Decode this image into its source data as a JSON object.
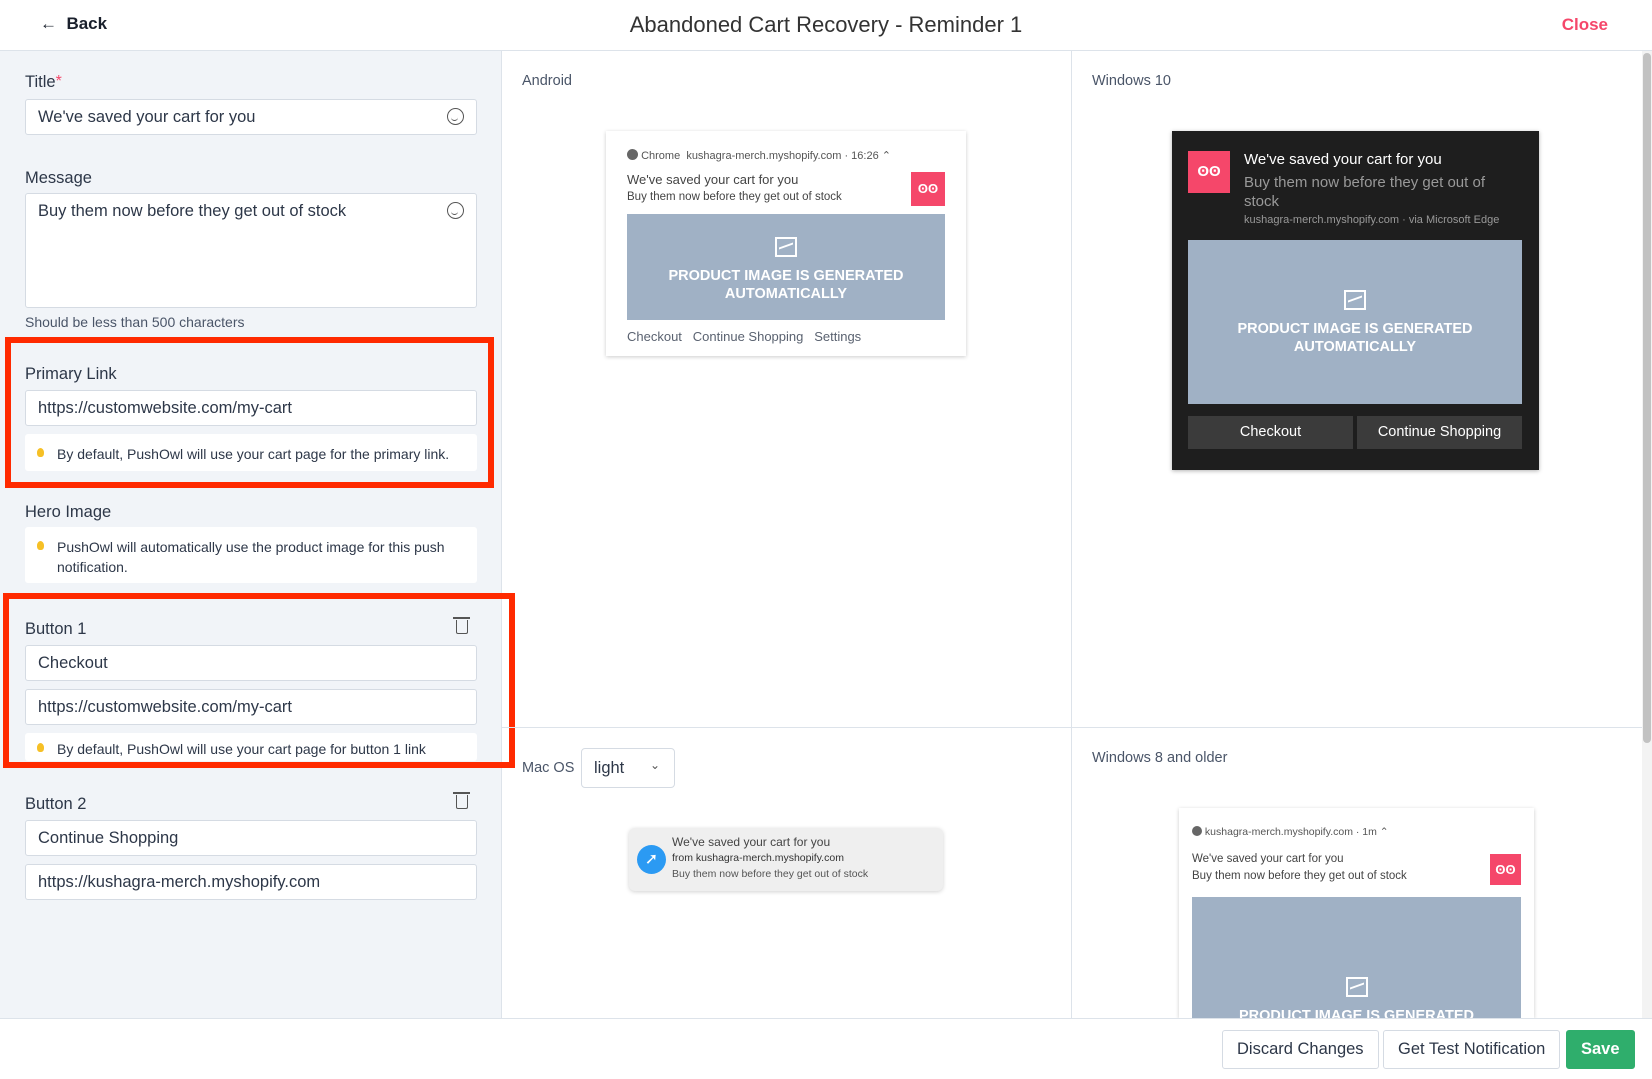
{
  "header": {
    "back": "Back",
    "title": "Abandoned Cart Recovery - Reminder 1",
    "close": "Close"
  },
  "form": {
    "title_label": "Title",
    "required_mark": "*",
    "title_value": "We've saved your cart for you",
    "message_label": "Message",
    "message_value": "Buy them now before they get out of stock",
    "message_helper": "Should be less than 500 characters",
    "primary_link_label": "Primary Link",
    "primary_link_value": "https://customwebsite.com/my-cart",
    "primary_link_info": "By default, PushOwl will use your cart page for the primary link.",
    "hero_label": "Hero Image",
    "hero_info": "PushOwl will automatically use the product image for this push notification.",
    "button1_label": "Button 1",
    "button1_text": "Checkout",
    "button1_link": "https://customwebsite.com/my-cart",
    "button1_info": "By default, PushOwl will use your cart page for button 1 link",
    "button2_label": "Button 2",
    "button2_text": "Continue Shopping",
    "button2_link": "https://kushagra-merch.myshopify.com"
  },
  "preview": {
    "notif_title": "We've saved your cart for you",
    "notif_message": "Buy them now before they get out of stock",
    "product_image": "PRODUCT IMAGE IS GENERATED AUTOMATICALLY",
    "android": {
      "label": "Android",
      "source": "Chrome",
      "site": "kushagra-merch.myshopify.com · 16:26",
      "actions": [
        "Checkout",
        "Continue Shopping",
        "Settings"
      ]
    },
    "windows10": {
      "label": "Windows 10",
      "site": "kushagra-merch.myshopify.com · via Microsoft Edge",
      "buttons": [
        "Checkout",
        "Continue Shopping"
      ]
    },
    "macos": {
      "label": "Mac OS",
      "theme": "light",
      "from": "from kushagra-merch.myshopify.com"
    },
    "windows8": {
      "label": "Windows 8 and older",
      "site": "kushagra-merch.myshopify.com · 1m"
    }
  },
  "footer": {
    "discard": "Discard Changes",
    "test": "Get Test Notification",
    "save": "Save"
  },
  "colors": {
    "accent": "#f5476a",
    "save": "#2fae6c",
    "highlight": "#ff2a00"
  }
}
